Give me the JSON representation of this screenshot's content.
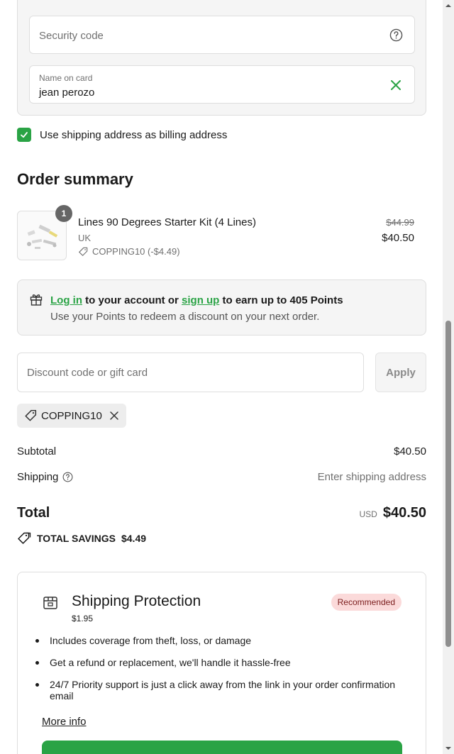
{
  "card_form": {
    "security_placeholder": "Security code",
    "name_label": "Name on card",
    "name_value": "jean perozo"
  },
  "billing": {
    "checked": true,
    "label": "Use shipping address as billing address"
  },
  "order_summary": {
    "heading": "Order summary",
    "item": {
      "quantity": "1",
      "name": "Lines 90 Degrees Starter Kit (4 Lines)",
      "variant": "UK",
      "discount": "COPPING10 (-$4.49)",
      "original_price": "$44.99",
      "price": "$40.50"
    }
  },
  "points": {
    "login_link": "Log in",
    "text_mid": " to your account or ",
    "signup_link": "sign up",
    "text_end": " to earn up to 405 Points",
    "subtext": "Use your Points to redeem a discount on your next order."
  },
  "discount": {
    "placeholder": "Discount code or gift card",
    "apply_label": "Apply",
    "applied_code": "COPPING10"
  },
  "totals": {
    "subtotal_label": "Subtotal",
    "subtotal_value": "$40.50",
    "shipping_label": "Shipping",
    "shipping_value": "Enter shipping address",
    "total_label": "Total",
    "currency": "USD",
    "total_value": "$40.50",
    "savings_label": "TOTAL SAVINGS",
    "savings_value": "$4.49"
  },
  "protection": {
    "title": "Shipping Protection",
    "price": "$1.95",
    "badge": "Recommended",
    "features": [
      "Includes coverage from theft, loss, or damage",
      "Get a refund or replacement, we'll handle it hassle-free",
      "24/7 Priority support is just a click away from the link in your order confirmation email"
    ],
    "more_info": "More info"
  },
  "colors": {
    "accent_green": "#2aa345",
    "badge_bg": "#fbdada"
  }
}
